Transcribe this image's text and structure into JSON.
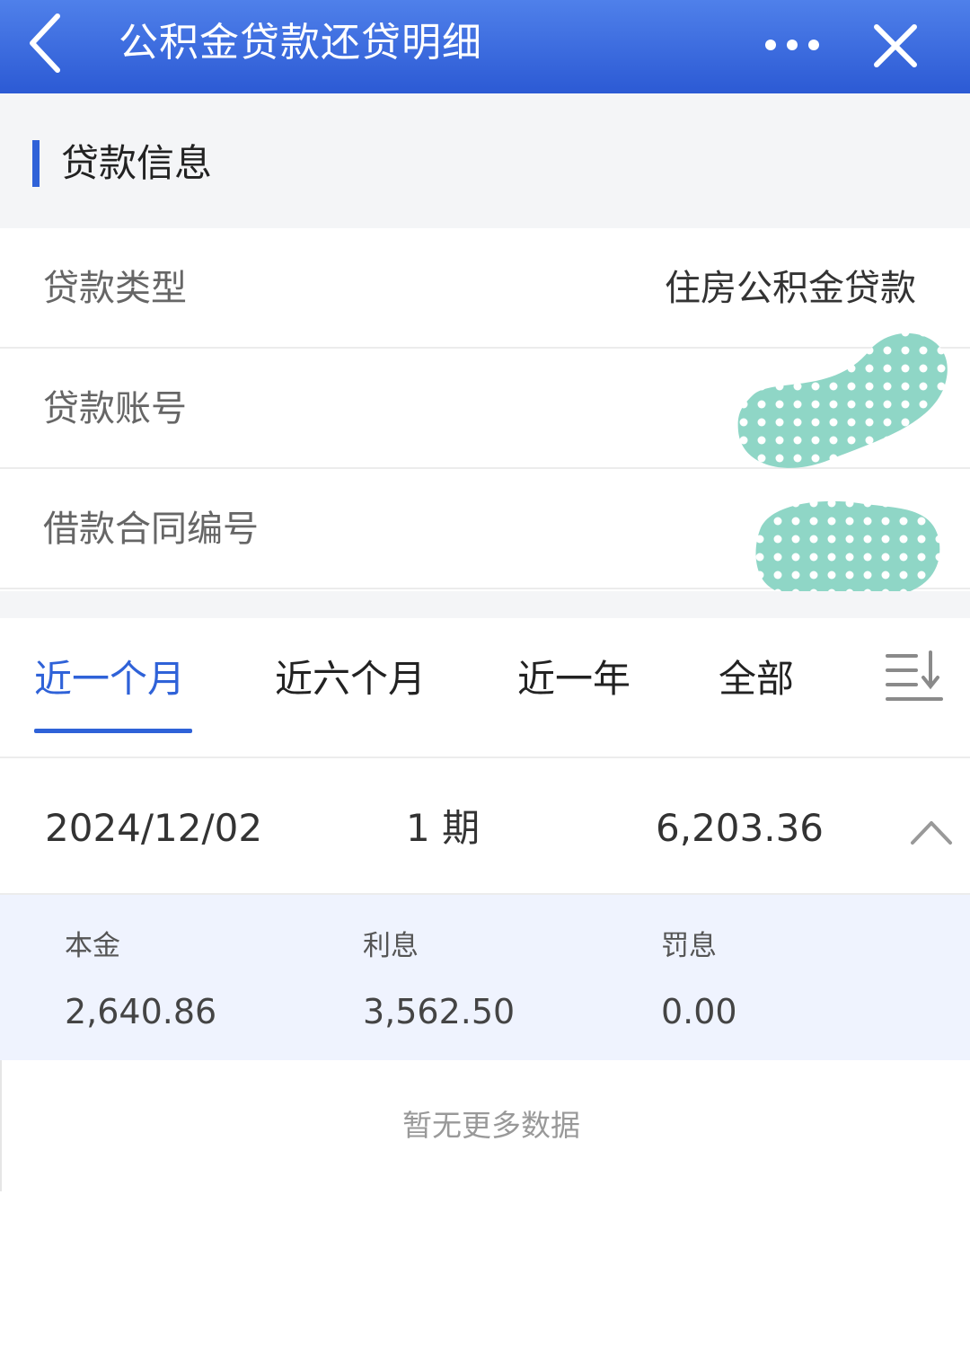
{
  "header": {
    "title": "公积金贷款还贷明细",
    "icons": [
      "chevron-left-icon",
      "more-icon",
      "close-icon"
    ]
  },
  "section": {
    "title": "贷款信息"
  },
  "loan_info": {
    "rows": [
      {
        "label": "贷款类型",
        "value": "住房公积金贷款"
      },
      {
        "label": "贷款账号",
        "value": ""
      },
      {
        "label": "借款合同编号",
        "value": ""
      }
    ]
  },
  "tabs": {
    "items": [
      "近一个月",
      "近六个月",
      "近一年",
      "全部"
    ],
    "active_index": 0,
    "sort_icon": "sort-descending-icon"
  },
  "record": {
    "date": "2024/12/02",
    "period": "1 期",
    "amount": "6,203.36",
    "expanded": true,
    "details": [
      {
        "label": "本金",
        "value": "2,640.86"
      },
      {
        "label": "利息",
        "value": "3,562.50"
      },
      {
        "label": "罚息",
        "value": "0.00"
      }
    ]
  },
  "footer": {
    "empty_text": "暂无更多数据"
  },
  "colors": {
    "header_top": "#4f80ea",
    "header_bottom": "#2c5ad4",
    "accent": "#2f62d8",
    "detail_bg": "#eff3fe",
    "redaction": "#8fd6c6"
  }
}
